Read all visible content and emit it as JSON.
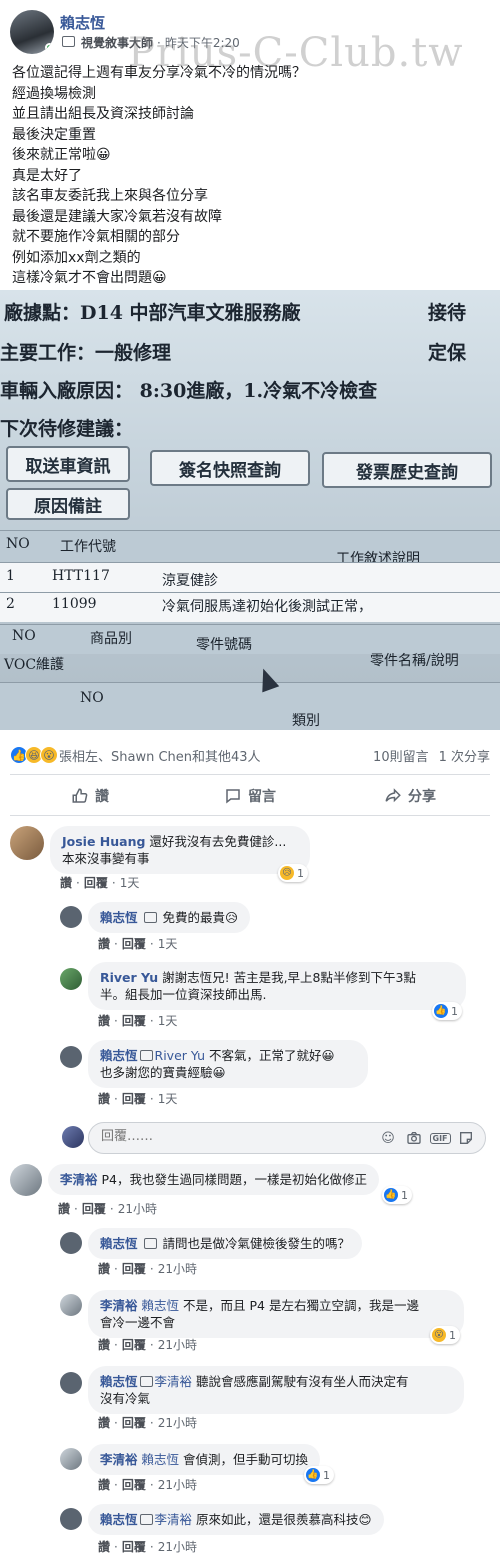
{
  "post": {
    "author": "賴志恆",
    "badge": "視覺敘事大師",
    "timestamp": "昨天下午2:20",
    "watermark": "Prius-C-Club.tw",
    "lines": [
      "各位還記得上週有車友分享冷氣不冷的情況嗎？",
      "經過換場檢測",
      "並且請出組長及資深技師討論",
      "最後決定重置",
      "後來就正常啦😀",
      "真是太好了",
      "該名車友委託我上來與各位分享",
      "最後還是建議大家冷氣若沒有故障",
      "就不要施作冷氣相關的部分",
      "例如添加xx劑之類的",
      "這樣冷氣才不會出問題😀"
    ]
  },
  "photo": {
    "line1": "廠據點：D14 中部汽車文雅服務廠",
    "line1_right": "接待",
    "line2": "主要工作：一般修理",
    "line2_right": "定保",
    "line3": "車輛入廠原因：  8:30進廠，1.冷氣不冷檢查",
    "line4": "下次待修建議：",
    "btn1": "取送車資訊",
    "btn2": "簽名快照查詢",
    "btn3": "發票歷史查詢",
    "btn4": "原因備註",
    "th_no": "NO",
    "th_code": "工作代號",
    "th_desc": "工作敘述說明",
    "r1_no": "1",
    "r1_code": "HTT117",
    "r1_desc": "涼夏健診",
    "r2_no": "2",
    "r2_code": "11099",
    "r2_desc": "冷氣伺服馬達初始化後測試正常，",
    "th2_no": "NO",
    "th2_cat": "商品別",
    "th2_part": "零件號碼",
    "th2_name": "零件名稱/說明",
    "th3_voc": "VOC維護",
    "th4_no": "NO",
    "th4_cat": "類別"
  },
  "reactions": {
    "summary": "張相左、Shawn Chen和其他43人",
    "comments_count": "10則留言",
    "shares_count": "1 次分享"
  },
  "actions": {
    "like": "讚",
    "comment": "留言",
    "share": "分享"
  },
  "comments": [
    {
      "name": "Josie Huang",
      "text1": "還好我沒有去免費健診...",
      "text2": "本來沒事變有事",
      "like": "讚",
      "reply": "回覆",
      "time": "1天",
      "react_count": "1"
    },
    {
      "name": "賴志恆",
      "text1": "免費的最貴😥",
      "like": "讚",
      "reply": "回覆",
      "time": "1天"
    },
    {
      "name": "River Yu",
      "text1": "謝謝志恆兄! 苦主是我,早上8點半修到下午3點",
      "text2": "半。組長加一位資深技師出馬.",
      "like": "讚",
      "reply": "回覆",
      "time": "1天",
      "react_count": "1"
    },
    {
      "name": "賴志恆",
      "tag": "River Yu",
      "text1": "不客氣，正常了就好😀",
      "text2": "也多謝您的寶貴經驗😀",
      "like": "讚",
      "reply": "回覆",
      "time": "1天"
    },
    {
      "name": "李清裕",
      "text1": "P4，我也發生過同樣問題，一樣是初始化做修正",
      "like": "讚",
      "reply": "回覆",
      "time": "21小時",
      "react_count": "1"
    },
    {
      "name": "賴志恆",
      "text1": "請問也是做冷氣健檢後發生的嗎？",
      "like": "讚",
      "reply": "回覆",
      "time": "21小時"
    },
    {
      "name": "李清裕",
      "tag": "賴志恆",
      "text1": "不是，而且 P4 是左右獨立空調，我是一邊",
      "text2": "會冷一邊不會",
      "like": "讚",
      "reply": "回覆",
      "time": "21小時",
      "react_count": "1"
    },
    {
      "name": "賴志恆",
      "tag": "李清裕",
      "text1": "聽說會感應副駕駛有沒有坐人而決定有",
      "text2": "沒有冷氣",
      "like": "讚",
      "reply": "回覆",
      "time": "21小時"
    },
    {
      "name": "李清裕",
      "tag": "賴志恆",
      "text1": "會偵測，但手動可切換",
      "like": "讚",
      "reply": "回覆",
      "time": "21小時",
      "react_count": "1"
    },
    {
      "name": "賴志恆",
      "tag": "李清裕",
      "text1": "原來如此，還是很羨慕高科技😊",
      "like": "讚",
      "reply": "回覆",
      "time": "21小時"
    }
  ],
  "reply_box": {
    "placeholder": "回覆……"
  },
  "colors": {
    "link": "#385898",
    "like_blue": "#1877f2",
    "bubble": "#f2f3f5",
    "meta": "#606770"
  }
}
